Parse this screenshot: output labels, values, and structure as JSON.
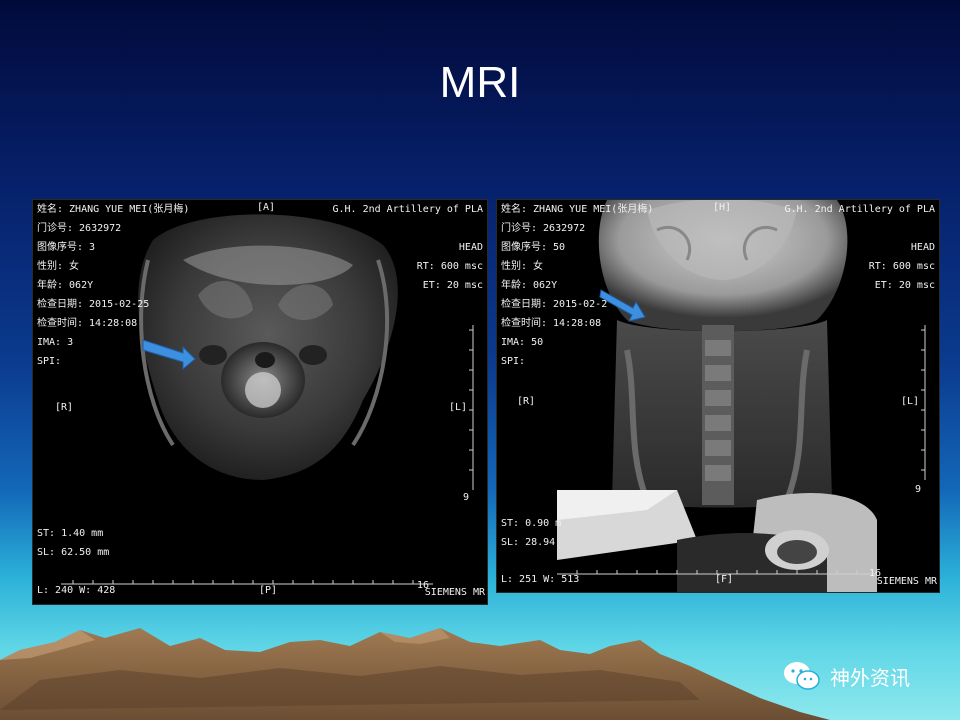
{
  "slide": {
    "title": "MRI"
  },
  "left_scan": {
    "name_line": "姓名: ZHANG YUE MEI(张月梅)",
    "id_line": "门诊号: 2632972",
    "seq_line": "图像序号: 3",
    "sex_line": "性别: 女",
    "age_line": "年龄: 062Y",
    "date_line": "检查日期: 2015-02-25",
    "time_line": "检查时间: 14:28:08",
    "ima_line": "IMA: 3",
    "spi_line": "SPI:",
    "hospital": "G.H. 2nd Artillery of PLA",
    "region": "HEAD",
    "rt": "RT: 600 msc",
    "et": "ET: 20 msc",
    "top_marker": "[A]",
    "left_marker": "[R]",
    "right_marker": "[L]",
    "bottom_marker": "[P]",
    "scale_num": "9",
    "scale_num2": "16",
    "st": "ST: 1.40 mm",
    "sl": "SL: 62.50 mm",
    "lw": "L: 240  W: 428",
    "vendor": "SIEMENS MR"
  },
  "right_scan": {
    "name_line": "姓名: ZHANG YUE MEI(张月梅)",
    "id_line": "门诊号: 2632972",
    "seq_line": "图像序号: 50",
    "sex_line": "性别: 女",
    "age_line": "年龄: 062Y",
    "date_line": "检查日期: 2015-02-2",
    "time_line": "检查时间: 14:28:08",
    "ima_line": "IMA: 50",
    "spi_line": "SPI:",
    "hospital": "G.H. 2nd Artillery of PLA",
    "region": "HEAD",
    "rt": "RT: 600 msc",
    "et": "ET: 20 msc",
    "top_marker": "[H]",
    "left_marker": "[R]",
    "right_marker": "[L]",
    "bottom_marker": "[F]",
    "scale_num": "9",
    "scale_num2": "16",
    "st": "ST: 0.90 m",
    "sl": "SL: 28.94",
    "lw": "L: 251  W: 513",
    "vendor": "SIEMENS MR"
  },
  "logo": {
    "text": "神外资讯",
    "icon": "wechat-icon"
  },
  "colors": {
    "arrow": "#3d8fe0",
    "mountain": "#8b6a48"
  }
}
